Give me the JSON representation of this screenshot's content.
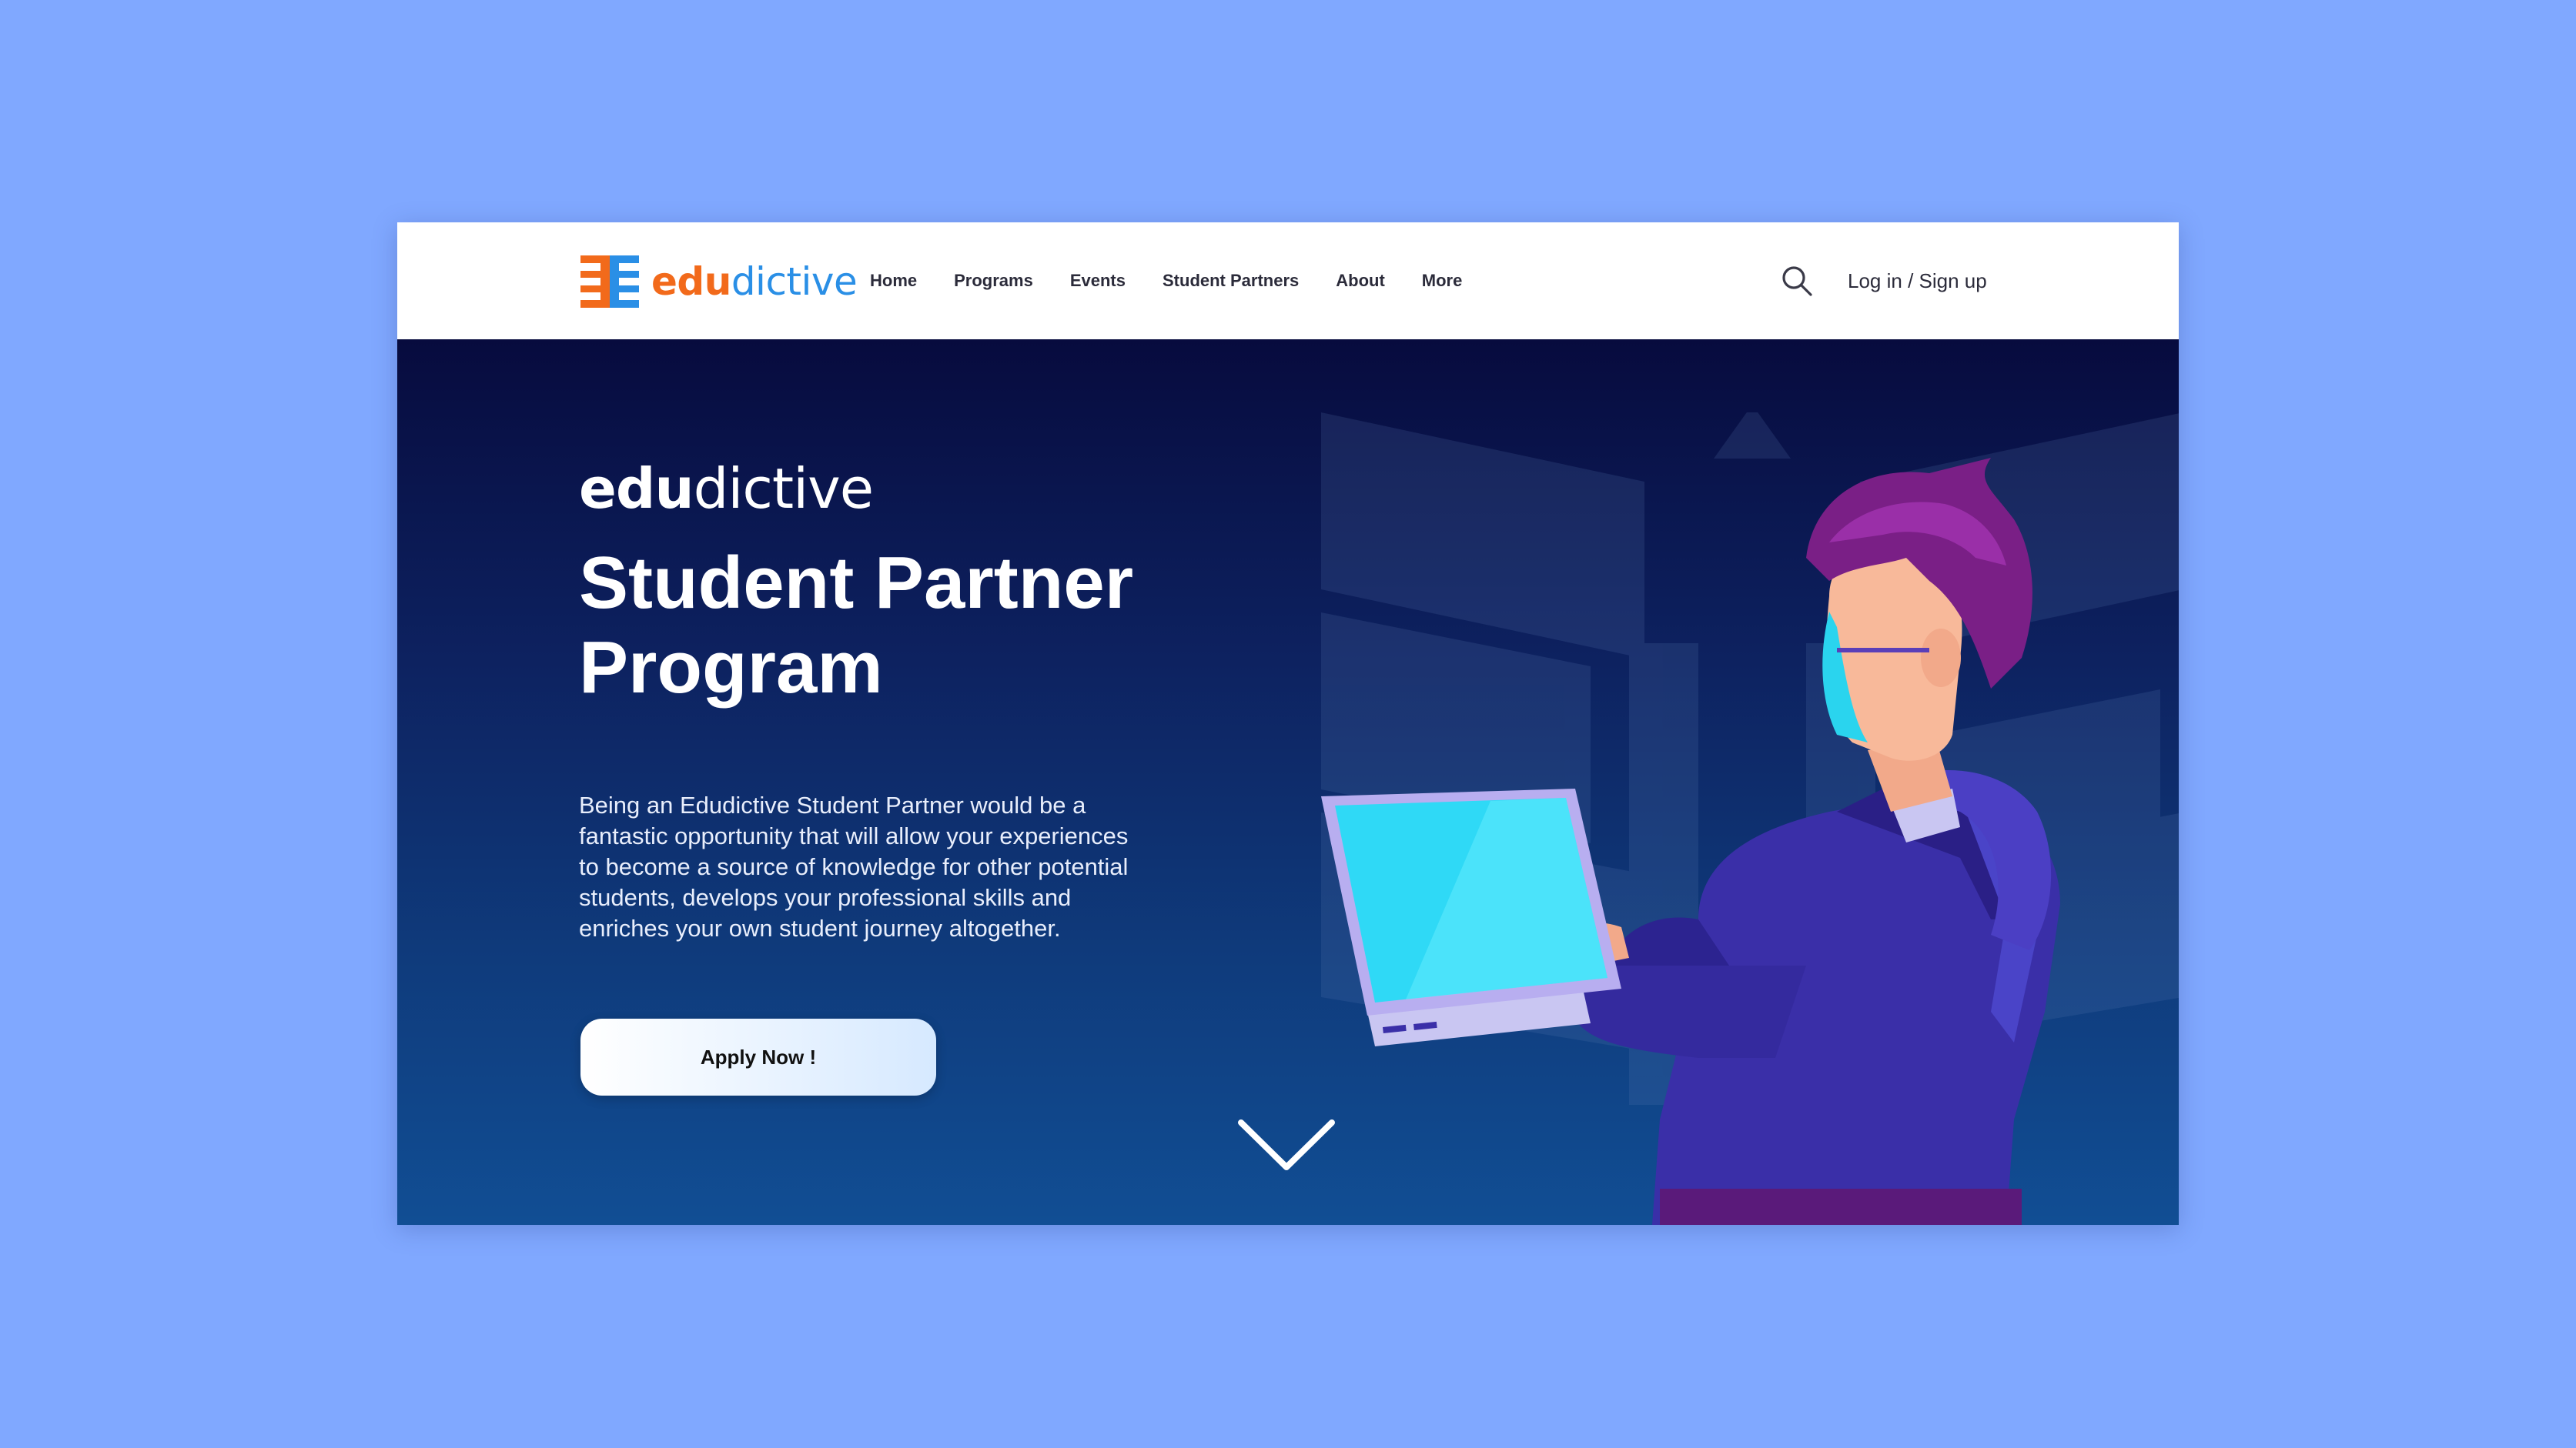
{
  "brand": {
    "name_part1": "edu",
    "name_part2": "dictive",
    "colors": {
      "edu": "#f26a1b",
      "dictive": "#2a8fe6"
    }
  },
  "nav": {
    "items": [
      {
        "label": "Home"
      },
      {
        "label": "Programs"
      },
      {
        "label": "Events"
      },
      {
        "label": "Student Partners"
      },
      {
        "label": "About"
      },
      {
        "label": "More"
      }
    ],
    "search_icon": "search-icon",
    "login_label": "Log in / Sign up"
  },
  "hero": {
    "brand_part1": "edu",
    "brand_part2": "dictive",
    "title_line1": "Student Partner",
    "title_line2": "Program",
    "description": "Being an Edudictive Student Partner would be a fantastic opportunity that will allow your experiences to become a source of knowledge for other potential students, develops your professional skills and enriches your own student journey altogether.",
    "apply_label": "Apply Now !",
    "scroll_icon": "chevron-down-icon",
    "illustration": "student-with-laptop-illustration",
    "colors": {
      "background_top": "#070b3e",
      "background_bottom": "#114e94",
      "screen": "#3ee6ff",
      "hoodie": "#3a2fa8",
      "hair": "#7a1f86"
    }
  },
  "page_background": "#80a8ff"
}
